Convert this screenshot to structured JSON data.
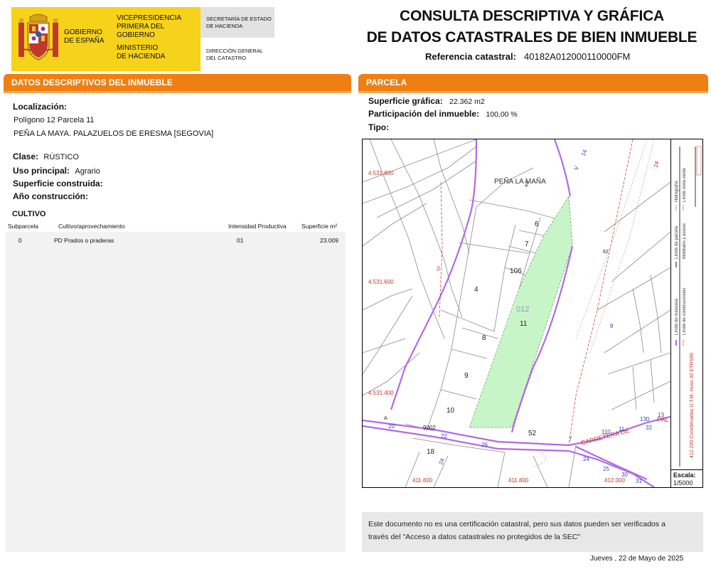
{
  "header": {
    "gov_line1": "GOBIERNO",
    "gov_line2": "DE ESPAÑA",
    "vice_line1": "VICEPRESIDENCIA",
    "vice_line2": "PRIMERA DEL GOBIERNO",
    "min_line1": "MINISTERIO",
    "min_line2": "DE HACIENDA",
    "sec_line1": "SECRETARÍA DE ESTADO",
    "sec_line2": "DE HACIENDA",
    "dgc_line1": "DIRECCIÓN GENERAL",
    "dgc_line2": "DEL CATASTRO",
    "title_line1": "CONSULTA DESCRIPTIVA Y GRÁFICA",
    "title_line2": "DE DATOS CATASTRALES DE BIEN INMUEBLE",
    "ref_label": "Referencia catastral:",
    "ref_value": "40182A012000110000FM"
  },
  "left": {
    "bar_title": "DATOS DESCRIPTIVOS DEL INMUEBLE",
    "loc_label": "Localización:",
    "loc_line1": "Polígono 12 Parcela 11",
    "loc_line2": "PEÑA LA MAYA. PALAZUELOS DE ERESMA [SEGOVIA]",
    "clase_label": "Clase:",
    "clase_value": "RÚSTICO",
    "uso_label": "Uso principal:",
    "uso_value": "Agrario",
    "sup_label": "Superficie construida:",
    "anio_label": "Año construcción:",
    "cultivo_title": "CULTIVO",
    "table": {
      "headers": [
        "Subparcela",
        "Cultivo/aprovechamiento",
        "Intensidad Productiva",
        "Superficie m²"
      ],
      "rows": [
        [
          "0",
          "PD Prados o praderas",
          "01",
          "23.009"
        ]
      ]
    }
  },
  "right": {
    "bar_title": "PARCELA",
    "sup_label": "Superficie gráfica:",
    "sup_value": "22.362 m2",
    "part_label": "Participación del inmueble:",
    "part_value": "100,00 %",
    "tipo_label": "Tipo:",
    "map": {
      "place_name": "PEÑA LA MAÑA",
      "coord_labels": [
        "4.531.800",
        "4.531.600",
        "4.531.400",
        "411.600",
        "411.800",
        "412.000"
      ],
      "parcel_numbers": [
        "2",
        "6",
        "7",
        "106",
        "4",
        "8",
        "9",
        "10",
        "11",
        "18",
        "52",
        "62",
        "9",
        "012"
      ],
      "road_label": "CARRETERA DE",
      "road_label2": "PAL",
      "road_numbers": [
        "20",
        "22",
        "24",
        "26",
        "7",
        "110",
        "11",
        "130",
        "13",
        "32",
        "24",
        "25",
        "30",
        "31",
        "9002",
        "A",
        "V",
        "14",
        "24",
        "60"
      ],
      "legend_items": [
        "Límite de manzana",
        "Límite de construcciones",
        "Límite de parcela",
        "Mobiliario y aceras",
        "Hidrografía",
        "Límite zona verde"
      ],
      "crs_text": "412.200 Coordenadas U.T.M. Huso 30 ETRS89",
      "scale_label": "Escala:",
      "scale_value": "1/5000",
      "colors": {
        "parcel_fill": "#c8f5c8",
        "parcel_outline": "#9a9a9a",
        "road": "#b469e6",
        "coord_text": "#c0392b"
      }
    }
  },
  "footer": {
    "disclaimer_line1": "Este documento no es una certificación catastral, pero sus datos pueden ser verificados a",
    "disclaimer_line2": "través del \"Acceso a datos catastrales no protegidos de la SEC\"",
    "date": "Jueves , 22 de Mayo de 2025"
  }
}
